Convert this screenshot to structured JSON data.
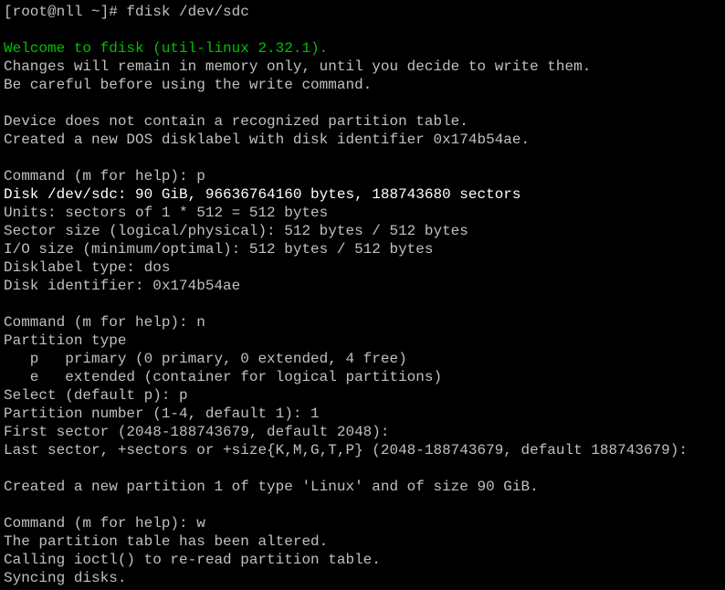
{
  "colors": {
    "background": "#000000",
    "text": "#c0c0c0",
    "highlight_green": "#00c000",
    "bright": "#ffffff"
  },
  "lines": [
    {
      "text": "[root@nll ~]# fdisk /dev/sdc",
      "style": ""
    },
    {
      "text": "",
      "style": ""
    },
    {
      "text": "Welcome to fdisk (util-linux 2.32.1).",
      "style": "green"
    },
    {
      "text": "Changes will remain in memory only, until you decide to write them.",
      "style": ""
    },
    {
      "text": "Be careful before using the write command.",
      "style": ""
    },
    {
      "text": "",
      "style": ""
    },
    {
      "text": "Device does not contain a recognized partition table.",
      "style": ""
    },
    {
      "text": "Created a new DOS disklabel with disk identifier 0x174b54ae.",
      "style": ""
    },
    {
      "text": "",
      "style": ""
    },
    {
      "text": "Command (m for help): p",
      "style": ""
    },
    {
      "text": "Disk /dev/sdc: 90 GiB, 96636764160 bytes, 188743680 sectors",
      "style": "bright"
    },
    {
      "text": "Units: sectors of 1 * 512 = 512 bytes",
      "style": ""
    },
    {
      "text": "Sector size (logical/physical): 512 bytes / 512 bytes",
      "style": ""
    },
    {
      "text": "I/O size (minimum/optimal): 512 bytes / 512 bytes",
      "style": ""
    },
    {
      "text": "Disklabel type: dos",
      "style": ""
    },
    {
      "text": "Disk identifier: 0x174b54ae",
      "style": ""
    },
    {
      "text": "",
      "style": ""
    },
    {
      "text": "Command (m for help): n",
      "style": ""
    },
    {
      "text": "Partition type",
      "style": ""
    },
    {
      "text": "   p   primary (0 primary, 0 extended, 4 free)",
      "style": ""
    },
    {
      "text": "   e   extended (container for logical partitions)",
      "style": ""
    },
    {
      "text": "Select (default p): p",
      "style": ""
    },
    {
      "text": "Partition number (1-4, default 1): 1",
      "style": ""
    },
    {
      "text": "First sector (2048-188743679, default 2048):",
      "style": ""
    },
    {
      "text": "Last sector, +sectors or +size{K,M,G,T,P} (2048-188743679, default 188743679):",
      "style": ""
    },
    {
      "text": "",
      "style": ""
    },
    {
      "text": "Created a new partition 1 of type 'Linux' and of size 90 GiB.",
      "style": ""
    },
    {
      "text": "",
      "style": ""
    },
    {
      "text": "Command (m for help): w",
      "style": ""
    },
    {
      "text": "The partition table has been altered.",
      "style": ""
    },
    {
      "text": "Calling ioctl() to re-read partition table.",
      "style": ""
    },
    {
      "text": "Syncing disks.",
      "style": ""
    }
  ]
}
